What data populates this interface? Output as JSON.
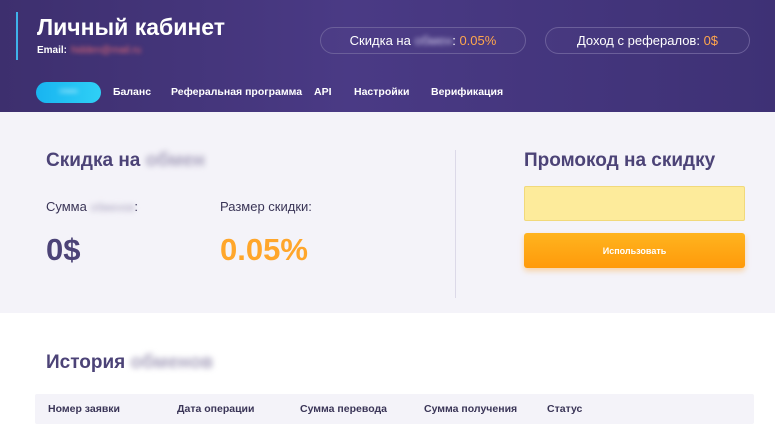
{
  "header": {
    "title": "Личный кабинет",
    "email_label": "Email:",
    "email_value": "hidden@mail.ru",
    "discount_pill": {
      "label": "Скидка на",
      "hidden": "обмен",
      "value": "0.05%"
    },
    "income_pill": {
      "label": "Доход с рефералов:",
      "value": "0$"
    }
  },
  "nav": {
    "active_label": "Обмен",
    "items": [
      "Баланс",
      "Реферальная программа",
      "API",
      "Настройки",
      "Верификация"
    ]
  },
  "discount": {
    "title": "Скидка на",
    "title_hidden": "обмен",
    "sum_label": "Сумма",
    "sum_hidden": "обменов",
    "sum_suffix": ":",
    "sum_value": "0$",
    "size_label": "Размер скидки:",
    "size_value": "0.05%"
  },
  "promo": {
    "title": "Промокод на скидку",
    "input_value": "",
    "input_placeholder": "",
    "button_label": "Использовать"
  },
  "history": {
    "title": "История",
    "title_hidden": "обменов",
    "columns": [
      "Номер заявки",
      "Дата операции",
      "Сумма перевода",
      "Сумма получения",
      "Статус"
    ]
  },
  "colors": {
    "header_bg": "#433579",
    "accent_blue": "#1fb8f2",
    "accent_orange": "#ffa62b",
    "title_purple": "#4c4377",
    "panel_bg": "#f4f3f9",
    "input_yellow": "#fdeb9b"
  }
}
